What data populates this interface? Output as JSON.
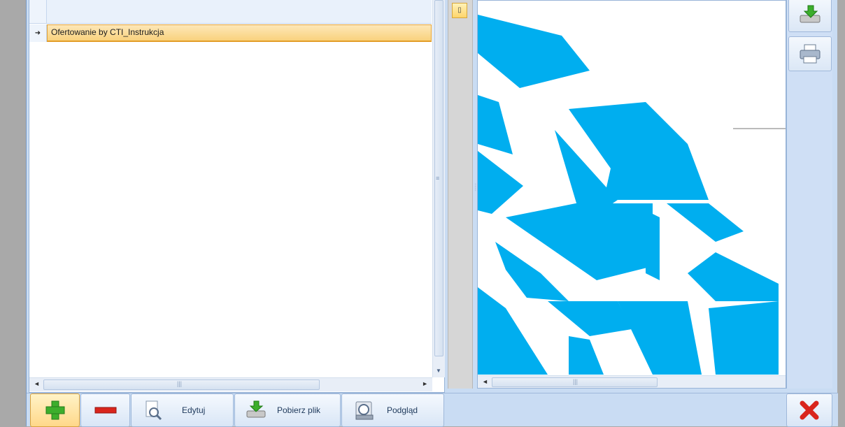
{
  "grid": {
    "rows": [
      {
        "indicator": "➜",
        "name": "Ofertowanie by CTI_Instrukcja"
      }
    ]
  },
  "toolbar": {
    "add_label": "",
    "remove_label": "",
    "edit_label": "Edytuj",
    "download_label": "Pobierz plik",
    "preview_label": "Podgląd"
  },
  "colors": {
    "accent": "#00aeef",
    "selected_row": "#f9d27d",
    "panel": "#c9dcf3",
    "close_red": "#d9251c",
    "add_green": "#3cae2c"
  },
  "icons": [
    "save-download-icon",
    "printer-icon",
    "pin-icon",
    "add-icon",
    "remove-icon",
    "edit-icon",
    "download-icon",
    "preview-icon",
    "close-icon"
  ]
}
